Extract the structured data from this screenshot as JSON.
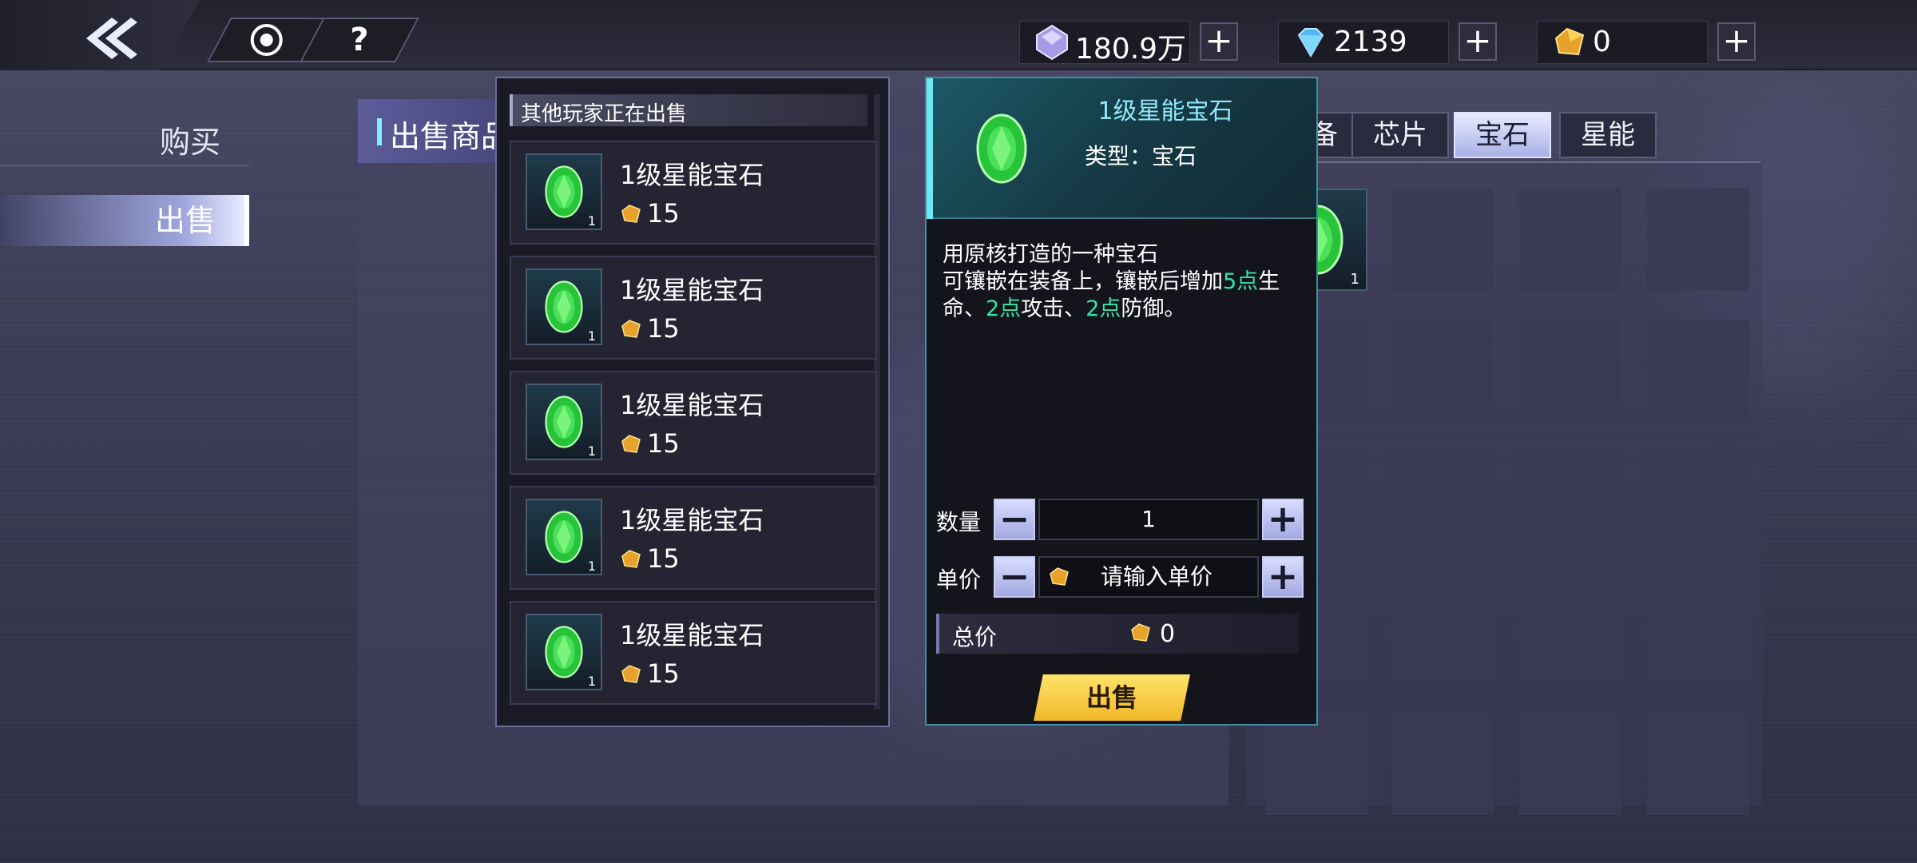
{
  "topbar": {
    "currencies": [
      {
        "icon": "crystal-icon",
        "value": "180.9万",
        "color": "#c7b9ff"
      },
      {
        "icon": "diamond-icon",
        "value": "2139",
        "color": "#5fd1ff"
      },
      {
        "icon": "gold-gem-icon",
        "value": "0",
        "color": "#f2b33a"
      }
    ],
    "plus_label": "+",
    "help_label": "?"
  },
  "nav": {
    "buy_label": "购买",
    "sell_label": "出售"
  },
  "sell_panel": {
    "title": "出售商品"
  },
  "tabs": [
    {
      "label": "装备"
    },
    {
      "label": "芯片"
    },
    {
      "label": "宝石"
    },
    {
      "label": "星能"
    }
  ],
  "active_tab": "宝石",
  "bag": {
    "first_item_count": "1"
  },
  "market_list": {
    "header": "其他玩家正在出售",
    "items": [
      {
        "name": "1级星能宝石",
        "price": "15",
        "count": "1"
      },
      {
        "name": "1级星能宝石",
        "price": "15",
        "count": "1"
      },
      {
        "name": "1级星能宝石",
        "price": "15",
        "count": "1"
      },
      {
        "name": "1级星能宝石",
        "price": "15",
        "count": "1"
      },
      {
        "name": "1级星能宝石",
        "price": "15",
        "count": "1"
      }
    ]
  },
  "detail": {
    "title": "1级星能宝石",
    "type": "类型：宝石",
    "desc_line1": "用原核打造的一种宝石",
    "desc_line2_a": "可镶嵌在装备上，镶嵌后增加",
    "desc_hl_1": "5点",
    "desc_line2_b": "生命、",
    "desc_hl_2": "2点",
    "desc_line2_c": "攻击、",
    "desc_hl_3": "2点",
    "desc_line2_d": "防御。",
    "quantity_label": "数量",
    "quantity_value": "1",
    "unit_price_label": "单价",
    "unit_price_placeholder": "请输入单价",
    "minus_label": "−",
    "plus_label": "+",
    "total_label": "总价",
    "total_value": "0",
    "sell_button": "出售"
  }
}
